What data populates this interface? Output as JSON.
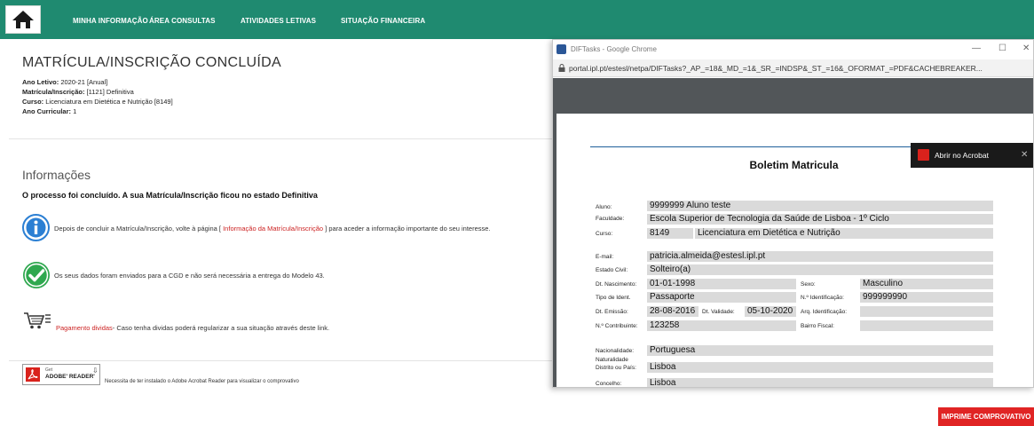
{
  "nav": {
    "items": [
      "MINHA INFORMAÇÃO",
      "ÁREA CONSULTAS",
      "ATIVIDADES LETIVAS",
      "SITUAÇÃO FINANCEIRA"
    ]
  },
  "page": {
    "title": "MATRÍCULA/INSCRIÇÃO CONCLUÍDA",
    "ano_letivo_label": "Ano Letivo:",
    "ano_letivo_value": "2020-21 [Anual]",
    "matricula_label": "Matrícula/Inscrição:",
    "matricula_value": "[1121] Definitiva",
    "curso_label": "Curso:",
    "curso_value": "Licenciatura em Dietética e Nutrição [8149]",
    "ano_curricular_label": "Ano Curricular:",
    "ano_curricular_value": "1",
    "info_title": "Informações",
    "processo_text": "O processo foi concluído. A sua Matrícula/Inscrição ficou no estado  Definitiva",
    "msg1_pre": "Depois de concluir a Matrícula/Inscrição, volte à página [",
    "msg1_link": " Informação da Matrícula/Inscrição ",
    "msg1_post": "] para aceder a informação importante do seu interesse.",
    "msg2": "Os seus dados foram enviados para a CGD e não será necessária a entrega do Modelo 43.",
    "msg3_link": "Pagamento dividas",
    "msg3_post": "- Caso tenha dividas poderá regularizar a sua situação através deste link.",
    "adobe_get": "Get",
    "adobe_reader": "ADOBE' READER'",
    "pdf_note": "Necessita de ter instalado o Adobe Acrobat Reader para visualizar o comprovativo",
    "print_button": "IMPRIME COMPROVATIVO"
  },
  "popup": {
    "window_title": "DIFTasks - Google Chrome",
    "url": "portal.ipl.pt/estesl/netpa/DIFTasks?_AP_=18&_MD_=1&_SR_=INDSP&_ST_=16&_OFORMAT_=PDF&CACHEBREAKER...",
    "acrobat_label": "Abrir no Acrobat",
    "pdf_title": "Boletim Matricula",
    "fields": {
      "aluno_label": "Aluno:",
      "aluno_value": "9999999  Aluno teste",
      "faculdade_label": "Faculdade:",
      "faculdade_value": "Escola Superior de Tecnologia da Saúde de Lisboa  - 1º Ciclo",
      "curso_label": "Curso:",
      "curso_code": "8149",
      "curso_value": "Licenciatura em Dietética e Nutrição",
      "email_label": "E-mail:",
      "email_value": "patricia.almeida@estesl.ipl.pt",
      "estado_civil_label": "Estado Civil:",
      "estado_civil_value": "Solteiro(a)",
      "dt_nasc_label": "Dt. Nascimento:",
      "dt_nasc_value": "01-01-1998",
      "sexo_label": "Sexo:",
      "sexo_value": "Masculino",
      "tipo_ident_label": "Tipo de Ident.",
      "tipo_ident_value": "Passaporte",
      "n_ident_label": "N.º Identificação:",
      "n_ident_value": "999999990",
      "dt_emissao_label": "Dt. Emissão:",
      "dt_emissao_value": "28-08-2016",
      "dt_validade_label": "Dt. Validade:",
      "dt_validade_value": "05-10-2020",
      "arq_ident_label": "Arq. Identificação:",
      "contribuinte_label": "N.º Contribuinte:",
      "contribuinte_value": "123258",
      "bairro_label": "Bairro Fiscal:",
      "nacionalidade_label": "Nacionalidade:",
      "nacionalidade_value": "Portuguesa",
      "naturalidade_label": "Naturalidade",
      "distrito_label": "Distrito ou País:",
      "distrito_value": "Lisboa",
      "concelho_label": "Concelho:",
      "concelho_value": "Lisboa"
    }
  }
}
